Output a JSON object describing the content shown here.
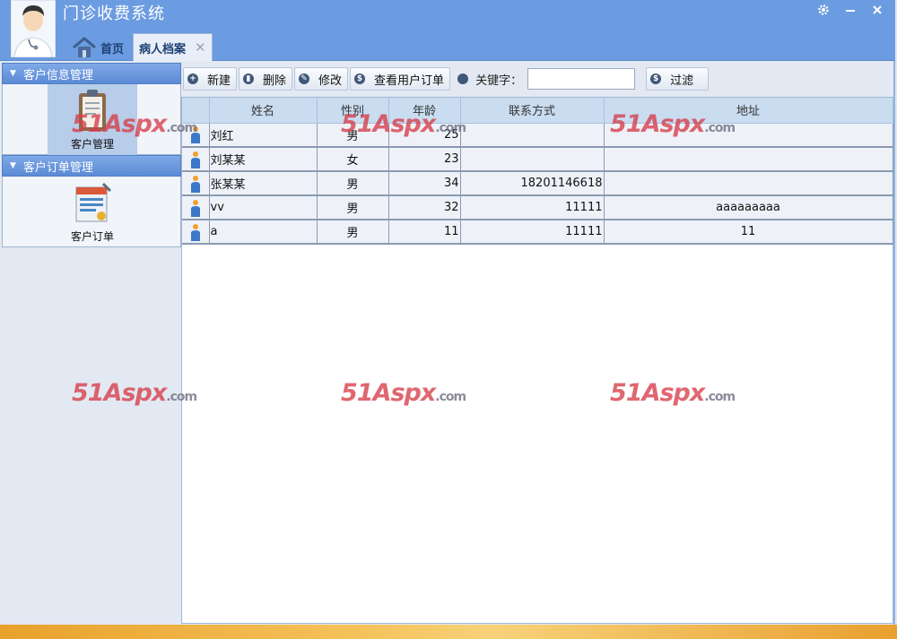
{
  "app": {
    "title": "门诊收费系统"
  },
  "tabs": {
    "home": "首页",
    "active": "病人档案"
  },
  "sidebar": {
    "sections": [
      {
        "title": "客户信息管理",
        "tile": "客户管理"
      },
      {
        "title": "客户订单管理",
        "tile": "客户订单"
      }
    ]
  },
  "toolbar": {
    "new": "新建",
    "delete": "删除",
    "edit": "修改",
    "view_orders": "查看用户订单",
    "keyword_label": "关键字：",
    "keyword_value": "",
    "filter": "过滤"
  },
  "table": {
    "columns": [
      "姓名",
      "性别",
      "年龄",
      "联系方式",
      "地址"
    ],
    "rows": [
      {
        "name": "刘红",
        "gender": "男",
        "age": "25",
        "contact": "",
        "address": ""
      },
      {
        "name": "刘某某",
        "gender": "女",
        "age": "23",
        "contact": "",
        "address": ""
      },
      {
        "name": "张某某",
        "gender": "男",
        "age": "34",
        "contact": "18201146618",
        "address": ""
      },
      {
        "name": "vv",
        "gender": "男",
        "age": "32",
        "contact": "11111",
        "address": "aaaaaaaaa"
      },
      {
        "name": "a",
        "gender": "男",
        "age": "11",
        "contact": "11111",
        "address": "11"
      }
    ]
  },
  "watermark": {
    "text": "51Aspx",
    "suffix": ".com"
  },
  "colors": {
    "header": "#6b9be0",
    "accent": "#5b8ad6",
    "watermark": "#d63c48"
  },
  "icons": [
    "user-avatar-icon",
    "settings-gear-icon",
    "minimize-icon",
    "close-icon",
    "home-icon",
    "plus-icon",
    "trash-icon",
    "pencil-icon",
    "dollar-icon",
    "list-icon",
    "person-icon",
    "clipboard-icon",
    "order-card-icon"
  ]
}
